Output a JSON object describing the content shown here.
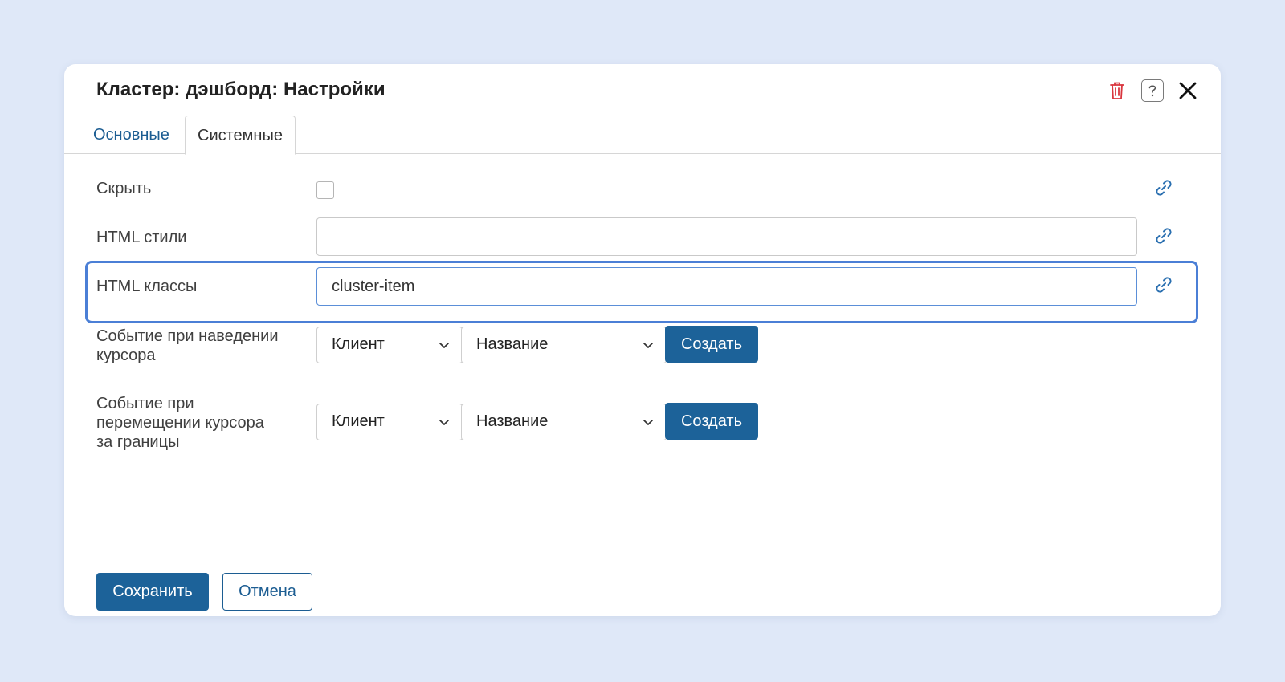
{
  "dialog": {
    "title": "Кластер: дэшборд: Настройки",
    "tabs": [
      {
        "label": "Основные",
        "active": false
      },
      {
        "label": "Системные",
        "active": true
      }
    ]
  },
  "form": {
    "hide": {
      "label": "Скрыть",
      "checked": false
    },
    "html_styles": {
      "label": "HTML стили",
      "value": ""
    },
    "html_classes": {
      "label": "HTML классы",
      "value": "cluster-item"
    },
    "hover_event": {
      "label_line1": "Событие при наведении",
      "label_line2": "курсора",
      "client_select": "Клиент",
      "name_select": "Название",
      "create_label": "Создать"
    },
    "leave_event": {
      "label_line1": "Событие при",
      "label_line2": "перемещении курсора",
      "label_line3": "за границы",
      "client_select": "Клиент",
      "name_select": "Название",
      "create_label": "Создать"
    }
  },
  "footer": {
    "save_label": "Сохранить",
    "cancel_label": "Отмена"
  },
  "colors": {
    "primary": "#1c6299",
    "focus": "#4b7fd6",
    "delete": "#d9363e",
    "background": "#dfe8f8"
  },
  "icons": {
    "delete": "trash-icon",
    "help": "help-icon",
    "close": "close-icon",
    "link": "link-icon",
    "dropdown": "chevron-down-icon"
  }
}
